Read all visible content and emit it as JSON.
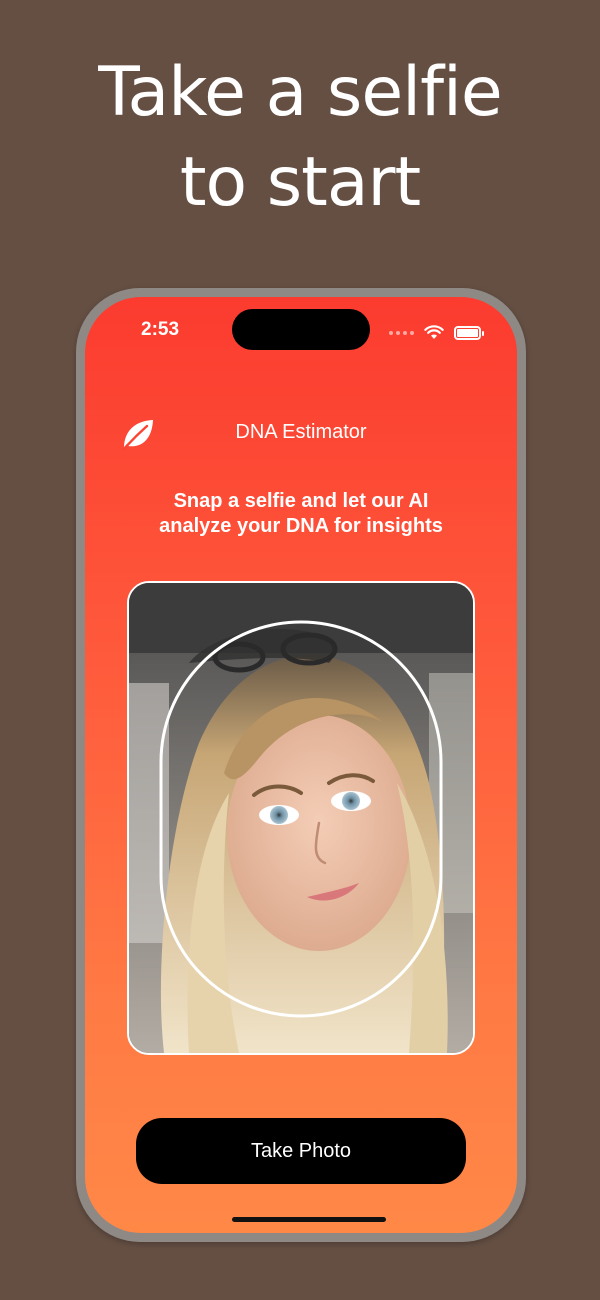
{
  "headline": {
    "line1": "Take a selfie",
    "line2": "to start"
  },
  "status_bar": {
    "time": "2:53"
  },
  "header": {
    "app_title": "DNA Estimator",
    "logo_icon": "leaf-icon"
  },
  "subtitle": {
    "line1": "Snap a selfie and let our AI",
    "line2": "analyze your DNA for insights"
  },
  "camera_preview": {
    "overlay_icon": "face-oval-guide"
  },
  "action": {
    "take_photo_label": "Take Photo"
  },
  "colors": {
    "background": "#654f43",
    "gradient_top": "#fb3b2f",
    "gradient_bottom": "#ff8847",
    "button": "#000000",
    "text": "#ffffff"
  }
}
